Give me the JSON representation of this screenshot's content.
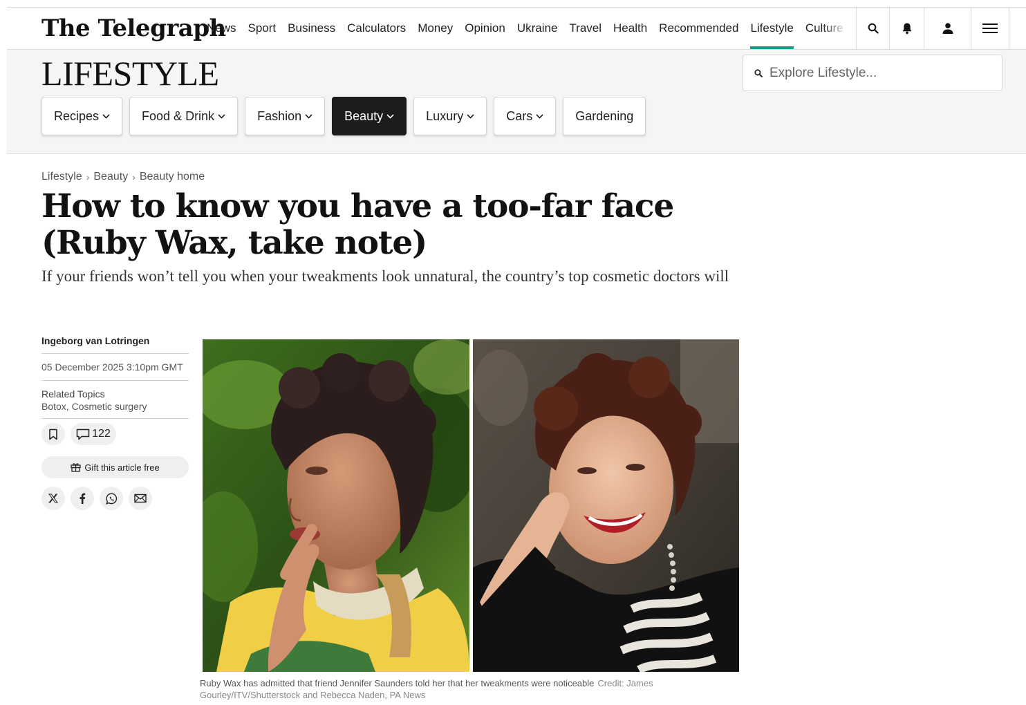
{
  "header": {
    "logo_text": "The Telegraph",
    "nav": [
      "News",
      "Sport",
      "Business",
      "Calculators",
      "Money",
      "Opinion",
      "Ukraine",
      "Travel",
      "Health",
      "Recommended",
      "Lifestyle",
      "Culture"
    ],
    "active_nav": "Lifestyle",
    "icons": [
      "search-icon",
      "bell-icon",
      "user-icon",
      "menu-icon"
    ]
  },
  "section": {
    "title": "LIFESTYLE",
    "search_placeholder": "Explore Lifestyle...",
    "subnav": [
      {
        "label": "Recipes",
        "has_dropdown": true
      },
      {
        "label": "Food & Drink",
        "has_dropdown": true
      },
      {
        "label": "Fashion",
        "has_dropdown": true
      },
      {
        "label": "Beauty",
        "has_dropdown": true,
        "active": true
      },
      {
        "label": "Luxury",
        "has_dropdown": true
      },
      {
        "label": "Cars",
        "has_dropdown": true
      },
      {
        "label": "Gardening",
        "has_dropdown": false
      }
    ]
  },
  "breadcrumb": [
    "Lifestyle",
    "Beauty",
    "Beauty home"
  ],
  "article": {
    "headline": "How to know you have a too-far face (Ruby Wax, take note)",
    "standfirst": "If your friends won’t tell you when your tweakments look unnatural, the country’s top cosmetic doctors will",
    "author": "Ingeborg van Lotringen",
    "date": "05 December 2025 3:10pm GMT",
    "related_label": "Related Topics",
    "related_topics": "Botox, Cosmetic surgery",
    "comment_count": "122",
    "gift_label": "Gift this article free",
    "share_icons": [
      "x-icon",
      "facebook-icon",
      "whatsapp-icon",
      "email-icon"
    ],
    "caption": "Ruby Wax has admitted that friend Jennifer Saunders told her that her tweakments were noticeable",
    "credit": "Credit: James Gourley/ITV/Shutterstock and Rebecca Naden, PA News"
  },
  "colors": {
    "accent": "#1e9a8d",
    "active_chip": "#1c1c1c",
    "band": "#f5f5f5"
  }
}
